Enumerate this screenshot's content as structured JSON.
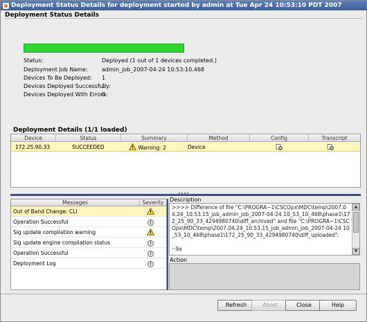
{
  "window": {
    "title": "Deployment Status Details for deployment started by admin at Tue Apr 24 10:53:10 PDT 2007"
  },
  "status_details": {
    "heading": "Deployment Status Details",
    "progress_percent": 100,
    "fields": [
      {
        "label": "Status:",
        "value": "Deployed  (1 out of 1 devices completed.)"
      },
      {
        "label": "Deployment Job Name:",
        "value": "admin_job_2007-04-24 10:53:10.468"
      },
      {
        "label": "Devices To Be Deployed:",
        "value": "1"
      },
      {
        "label": "Devices Deployed Successfully:",
        "value": "1"
      },
      {
        "label": "Devices Deployed With Errors:",
        "value": "0"
      }
    ]
  },
  "deployment_details": {
    "heading": "Deployment Details (1/1 loaded)",
    "columns": [
      "Device",
      "Status",
      "Summary",
      "Method",
      "Config",
      "Transcript"
    ],
    "rows": [
      {
        "device": "172.25.90.33",
        "status": "SUCCEEDED",
        "summary": "Warning: 2",
        "method": "Device"
      }
    ]
  },
  "messages": {
    "columns": [
      "Messages",
      "Severity"
    ],
    "rows": [
      {
        "text": "Out of Band Change: CLI",
        "severity": "warning"
      },
      {
        "text": "Operation Successful",
        "severity": "info"
      },
      {
        "text": "Sig update compilation warning",
        "severity": "warning"
      },
      {
        "text": "Sig update engine compilation status",
        "severity": "info"
      },
      {
        "text": "Operation Successful",
        "severity": "info"
      },
      {
        "text": "Deployment Log",
        "severity": "info"
      }
    ]
  },
  "description": {
    "label": "Description",
    "text": ">>>> Difference of file \"C:\\PROGRA~1\\CSCOpx\\MDC\\temp\\2007.04.24_10.53.15_job_admin_job_2007-04-24 10_53_10_468\\phase1\\172_25_90_33_4294980740\\diff_archived\" and file \"C:\\PROGRA~1\\CSCOpx\\MDC\\temp\\2007.04.24_10.53.15_job_admin_job_2007-04-24 10_53_10_468\\phase1\\172_25_90_33_4294980740\\diff_uploaded\".\n\n--9a\n>"
  },
  "action": {
    "label": "Action"
  },
  "buttons": {
    "refresh": "Refresh",
    "abort": "Abort",
    "close": "Close",
    "help": "Help"
  }
}
